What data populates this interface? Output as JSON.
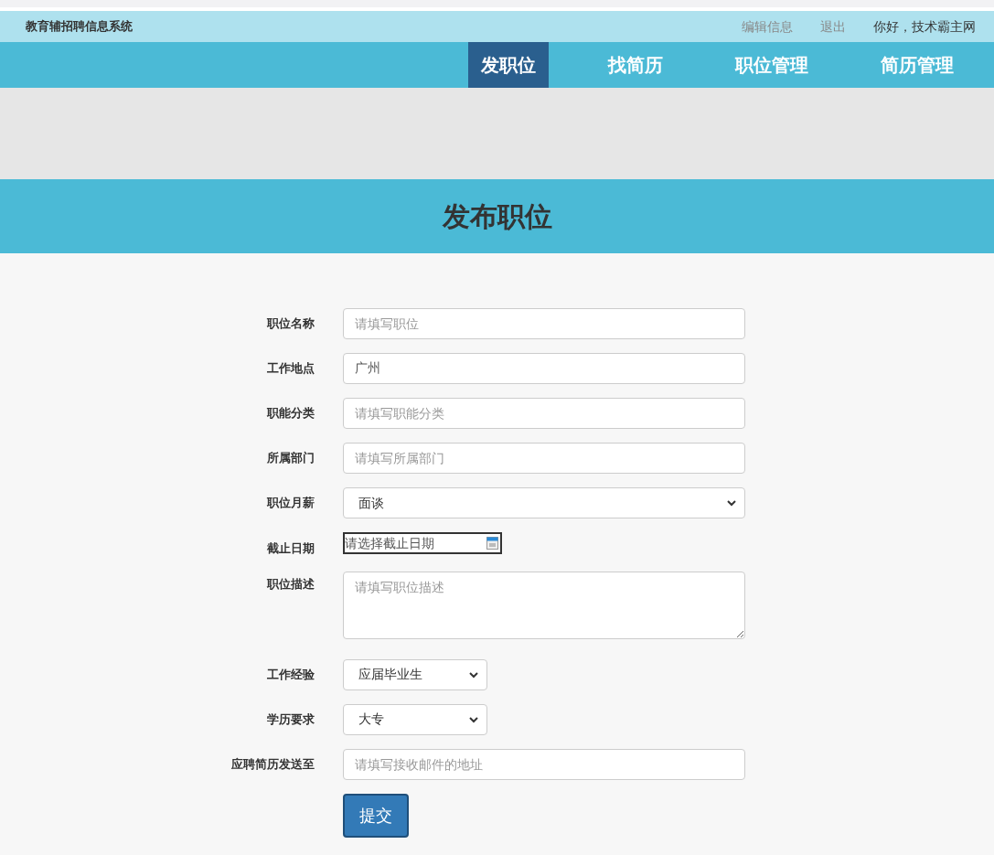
{
  "header": {
    "site_title": "教育辅招聘信息系统",
    "links": [
      {
        "label": "编辑信息"
      },
      {
        "label": "退出"
      }
    ],
    "greeting": "你好，技术霸主网"
  },
  "nav": [
    {
      "label": "发职位",
      "selected": true
    },
    {
      "label": "找简历",
      "selected": false
    },
    {
      "label": "职位管理",
      "selected": false
    },
    {
      "label": "简历管理",
      "selected": false
    }
  ],
  "page_title": "发布职位",
  "form": {
    "fields": [
      {
        "label": "职位名称",
        "kind": "text",
        "placeholder": "请填写职位"
      },
      {
        "label": "工作地点",
        "kind": "text",
        "value": "广州"
      },
      {
        "label": "职能分类",
        "kind": "text",
        "placeholder": "请填写职能分类"
      },
      {
        "label": "所属部门",
        "kind": "text",
        "placeholder": "请填写所属部门"
      },
      {
        "label": "职位月薪",
        "kind": "select",
        "value": "面谈"
      },
      {
        "label": "截止日期",
        "kind": "date",
        "placeholder": "请选择截止日期"
      },
      {
        "label": "职位描述",
        "kind": "textarea",
        "placeholder": "请填写职位描述"
      },
      {
        "label": "工作经验",
        "kind": "choice",
        "value": "应届毕业生"
      },
      {
        "label": "学历要求",
        "kind": "choice",
        "value": "大专"
      },
      {
        "label": "应聘简历发送至",
        "kind": "text",
        "placeholder": "请填写接收邮件的地址"
      }
    ],
    "submit": "提交"
  }
}
